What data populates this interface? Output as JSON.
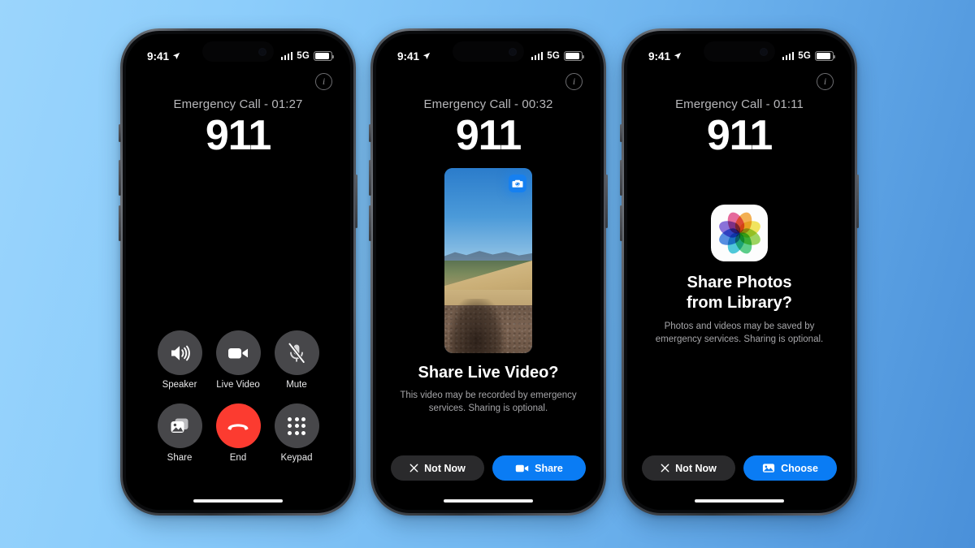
{
  "background": {
    "gradient_start": "#9bd5fc",
    "gradient_end": "#4a90d9"
  },
  "shared": {
    "status_time": "9:41",
    "network": "5G",
    "location_icon": "location-arrow-icon",
    "signal_icon": "cellular-bars-icon",
    "battery_icon": "battery-icon",
    "info_icon": "info-circle-icon",
    "call_number": "911"
  },
  "phones": [
    {
      "id": "phone-1",
      "screen": "call-controls",
      "call_label": "Emergency Call - 01:27",
      "call_number": "911",
      "controls": [
        {
          "label": "Speaker",
          "icon": "speaker-icon",
          "style": "gray"
        },
        {
          "label": "Live Video",
          "icon": "video-icon",
          "style": "gray"
        },
        {
          "label": "Mute",
          "icon": "mic-muted-icon",
          "style": "gray"
        },
        {
          "label": "Share",
          "icon": "photos-stack-icon",
          "style": "gray"
        },
        {
          "label": "End",
          "icon": "end-call-icon",
          "style": "red"
        },
        {
          "label": "Keypad",
          "icon": "keypad-icon",
          "style": "gray"
        }
      ],
      "end_button_color": "#fc3b30"
    },
    {
      "id": "phone-2",
      "screen": "share-live-video",
      "call_label": "Emergency Call - 00:32",
      "call_number": "911",
      "preview": {
        "name": "live-video-preview",
        "flip_icon": "camera-flip-icon",
        "flip_button_color": "#1680f0"
      },
      "sheet": {
        "title": "Share Live Video?",
        "subtitle": "This video may be recorded by emergency services. Sharing is optional.",
        "secondary_label": "Not Now",
        "secondary_icon": "close-x-icon",
        "primary_label": "Share",
        "primary_icon": "video-icon",
        "primary_color": "#0a7cf4"
      }
    },
    {
      "id": "phone-3",
      "screen": "share-photos",
      "call_label": "Emergency Call - 01:11",
      "call_number": "911",
      "app_icon": "photos-app-icon",
      "sheet": {
        "title_line1": "Share Photos",
        "title_line2": "from Library?",
        "subtitle": "Photos and videos may be saved by emergency services. Sharing is optional.",
        "secondary_label": "Not Now",
        "secondary_icon": "close-x-icon",
        "primary_label": "Choose",
        "primary_icon": "photo-icon",
        "primary_color": "#0a7cf4"
      }
    }
  ]
}
